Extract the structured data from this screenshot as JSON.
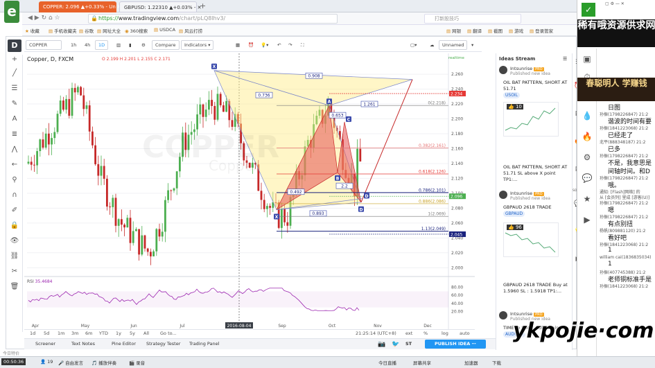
{
  "browser": {
    "tab1_title": "COPPER: 2.096 ▲+0.33% - Un",
    "tab2_title": "GBPUSD: 1.22310 ▲+0.03% -",
    "url_scheme": "https://",
    "url_host": "www.tradingview.com",
    "url_path": "/chart/pLQ8lhv3/",
    "search_placeholder": "打新股技巧"
  },
  "bookmarks": [
    "收藏",
    "手机收藏夹",
    "谷歌",
    "网址大全",
    "360搜索",
    "USDCA",
    "风云打捞"
  ],
  "bookmarks_right": [
    "网银",
    "翻译",
    "截图",
    "游戏",
    "登录管家"
  ],
  "toolbar": {
    "symbol": "COPPER",
    "intervals": [
      "1h",
      "4h",
      "1D"
    ],
    "compare": "Compare",
    "indicators": "Indicators",
    "layout_name": "Unnamed"
  },
  "chart_header": {
    "title": "Copper, D, FXCM",
    "ohlc": "O 2.199 H 2.201 L 2.155 C 2.171",
    "realtime": "realtime"
  },
  "watermark_symbol": "COPPER",
  "watermark_sub": "Copper",
  "chart_data": {
    "type": "candlestick",
    "x_ticks": [
      "Apr",
      "May",
      "Jun",
      "Jul",
      "2016-08-04",
      "Sep",
      "Oct",
      "Nov",
      "Dec"
    ],
    "y_ticks": [
      2.26,
      2.24,
      2.22,
      2.2,
      2.18,
      2.16,
      2.14,
      2.12,
      2.1,
      2.08,
      2.06,
      2.04,
      2.02,
      2.0
    ],
    "ylim": [
      1.99,
      2.275
    ],
    "price_labels": [
      {
        "value": 2.234,
        "text": "2.234",
        "color": "#e53935"
      },
      {
        "value": 2.096,
        "text": "2.096",
        "color": "#4caf50"
      },
      {
        "value": 2.045,
        "text": "2.045",
        "color": "#1a237e"
      }
    ],
    "fib_levels": [
      {
        "label": "0(2.218)",
        "value": 2.218
      },
      {
        "label": "0.382(2.161)",
        "value": 2.161
      },
      {
        "label": "0.618(2.126)",
        "value": 2.126
      },
      {
        "label": "0.786(2.101)",
        "value": 2.101
      },
      {
        "label": "0.886(2.086)",
        "value": 2.086
      },
      {
        "label": "1(2.069)",
        "value": 2.069
      },
      {
        "label": "1.13(2.049)",
        "value": 2.049
      }
    ],
    "pattern_points": [
      "X",
      "A",
      "B",
      "C",
      "D",
      "X",
      "D"
    ],
    "pattern_ratios": [
      "0.908",
      "0.736",
      "1.261",
      "0.653",
      "0.492",
      "2.2",
      "0.893"
    ],
    "rsi": {
      "label": "RSI",
      "value": "35.4684",
      "ticks": [
        80,
        60,
        40,
        20
      ]
    },
    "crosshair_date": "2016-08-04"
  },
  "timeframes": [
    "1d",
    "5d",
    "1m",
    "3m",
    "6m",
    "YTD",
    "1y",
    "5y",
    "All",
    "Go to..."
  ],
  "clock": "21:25:14 (UTC+8)",
  "scale_opts": [
    "ext",
    "%",
    "log",
    "auto"
  ],
  "panels": [
    "Screener",
    "Text Notes",
    "Pine Editor",
    "Strategy Tester",
    "Trading Panel"
  ],
  "publish": "PUBLISH IDEA",
  "st_label": "ST",
  "ideas": {
    "title": "Ideas Stream",
    "items": [
      {
        "author": "Intsunrise",
        "published": "Published new idea",
        "title": "OIL BAT PATTERN, SHORT AT 51.71",
        "symbol": "USOIL",
        "likes": "10"
      },
      {
        "author": "",
        "published": "",
        "title": "OIL BAT PATTERN, SHORT AT 51.71 SL above X point TP1:...",
        "symbol": "",
        "likes": ""
      },
      {
        "author": "Intsunrise",
        "published": "Published new idea",
        "title": "GBPAUD 2618 TRADE",
        "symbol": "GBPAUD",
        "likes": "96"
      },
      {
        "author": "",
        "published": "",
        "title": "GBPAUD 2618 TRADE Buy at 1.5960 SL : 1.5918 TP1:...",
        "symbol": "",
        "likes": ""
      },
      {
        "author": "Intsunrise",
        "published": "Published new idea",
        "title": "TIME to Short AUD Again",
        "symbol": "AUDUSD",
        "likes": ""
      }
    ]
  },
  "social_label": "SOCIAL",
  "chat": {
    "logo": "稀有哦资源供求网",
    "banner": "春聪明人 学赚钱",
    "lines": [
      {
        "meta": "",
        "msg": "日图"
      },
      {
        "meta": "孙振(1798226847) 21:2",
        "msg": "谐波的时间有要"
      },
      {
        "meta": "孙振(1841223068) 21:2",
        "msg": "已经走了"
      },
      {
        "meta": "北平(888348187) 21:2",
        "msg": "已多"
      },
      {
        "meta": "孙振(1798226847) 21:2",
        "msg": "不是，我意思是"
      },
      {
        "meta": "",
        "msg": "间轴时间。和D"
      },
      {
        "meta": "孙振(1798226847) 21:2",
        "msg": "哦。"
      },
      {
        "meta": "通知: [Flash]网络] 的",
        "msg": ""
      },
      {
        "meta": "从 [会员列] 里成 [游客(U)]",
        "msg": ""
      },
      {
        "meta": "孙振(1798226847) 21:2",
        "msg": "嗯"
      },
      {
        "meta": "孙振(1798226847) 21:2",
        "msg": "有点别扭"
      },
      {
        "meta": "杨帆(809881120) 21:2",
        "msg": "看好吧"
      },
      {
        "meta": "孙振(1841223068) 21:2",
        "msg": "1"
      },
      {
        "meta": "william cai(1836835034)",
        "msg": "1"
      },
      {
        "meta": "孙振(407745388) 21:2",
        "msg": "老师铜标准手是"
      },
      {
        "meta": "孙振(1841223068) 21:2",
        "msg": ""
      }
    ],
    "side_labels": [
      "视频",
      "文档",
      "",
      "",
      "",
      "",
      "",
      "",
      ""
    ]
  },
  "watermark_text": "ykpojie·com",
  "taskbar": {
    "timer": "00:50:36",
    "count": "19",
    "items": [
      "自由发言",
      "播放伴奏",
      "录音"
    ],
    "right_items": [
      "今日直播",
      "屏幕共享",
      "加速器",
      "下载"
    ]
  },
  "status_left": "今日特价"
}
